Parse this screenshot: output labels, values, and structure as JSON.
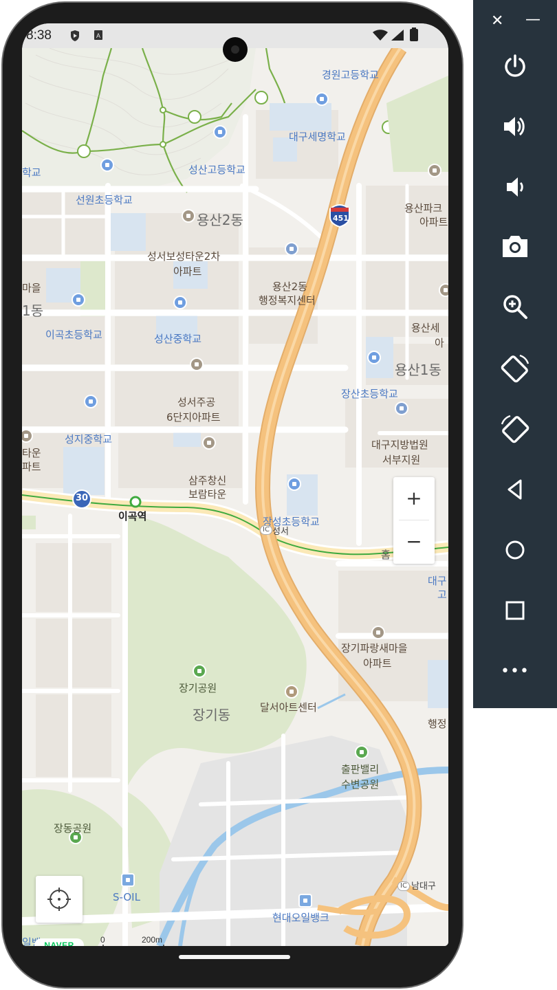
{
  "status_bar": {
    "time": "8:38"
  },
  "map": {
    "labels": {
      "school_top": "경원고등학교",
      "daegu_semyeong": "대구세명학교",
      "seongsan_high": "성산고등학교",
      "school_left_top": "학교",
      "seonwon_elem": "선원초등학교",
      "yongsan2": "용산2동",
      "yongsan_park": "용산파크",
      "yongsan_park2": "아파트",
      "seoboseong1": "성서보성타운2차",
      "seoboseong2": "아파트",
      "maeul": "마을",
      "yongsan2_office1": "용산2동",
      "yongsan2_office2": "행정복지센터",
      "dong1": "1동",
      "yongsan_se1": "용산세",
      "yongsan_se2": "아",
      "igok_elem": "이곡초등학교",
      "seongsan_middle": "성산중학교",
      "yongsan1": "용산1동",
      "jangsan_elem": "장산초등학교",
      "seoseo_jugong1": "성서주공",
      "seoseo_jugong2": "6단지아파트",
      "seongji_middle": "성지중학교",
      "court1": "대구지방법원",
      "court2": "서부지원",
      "left_town1": "타운",
      "left_town2": "파트",
      "samju1": "삼주창신",
      "samju2": "보람타운",
      "jangseong_elem": "장성초등학교",
      "ic_label": "성서",
      "ic_badge": "IC",
      "hom": "홈",
      "station": "이곡역",
      "daegu_r1": "대구",
      "daegu_r2": "고",
      "janggi_paran1": "장기파랑새마을",
      "janggi_paran2": "아파트",
      "janggi_park": "장기공원",
      "janggi_dong": "장기동",
      "dalseo_art": "달서아트센터",
      "haengjeong_r": "행정",
      "chulpan1": "출판밸리",
      "chulpan2": "수변공원",
      "jangdong_park": "장동공원",
      "namdaegu": "남대구",
      "namdaegu_ic": "IC",
      "soil": "S-OIL",
      "hyundai_oilbank": "현대오일뱅크",
      "oilbank_left": "일뱅크",
      "highway_no": "451",
      "road_no": "30"
    },
    "zoom_in": "+",
    "zoom_out": "−",
    "logo": "NAVER",
    "scale_start": "0",
    "scale_end": "200m"
  },
  "emulator_sidebar": {
    "close": "✕",
    "minimize": "—",
    "more": "•••",
    "items": [
      "power-icon",
      "volume-up-icon",
      "volume-down-icon",
      "camera-icon",
      "zoom-icon",
      "rotate-left-icon",
      "rotate-right-icon",
      "back-icon",
      "home-icon",
      "overview-icon",
      "more-icon"
    ]
  },
  "colors": {
    "highway": "#f5c27e",
    "road": "#ffffff",
    "park": "#dde8cc",
    "water": "#9bc7ea",
    "metro_line": "#3faa3f",
    "sidebar_bg": "#27333d"
  }
}
